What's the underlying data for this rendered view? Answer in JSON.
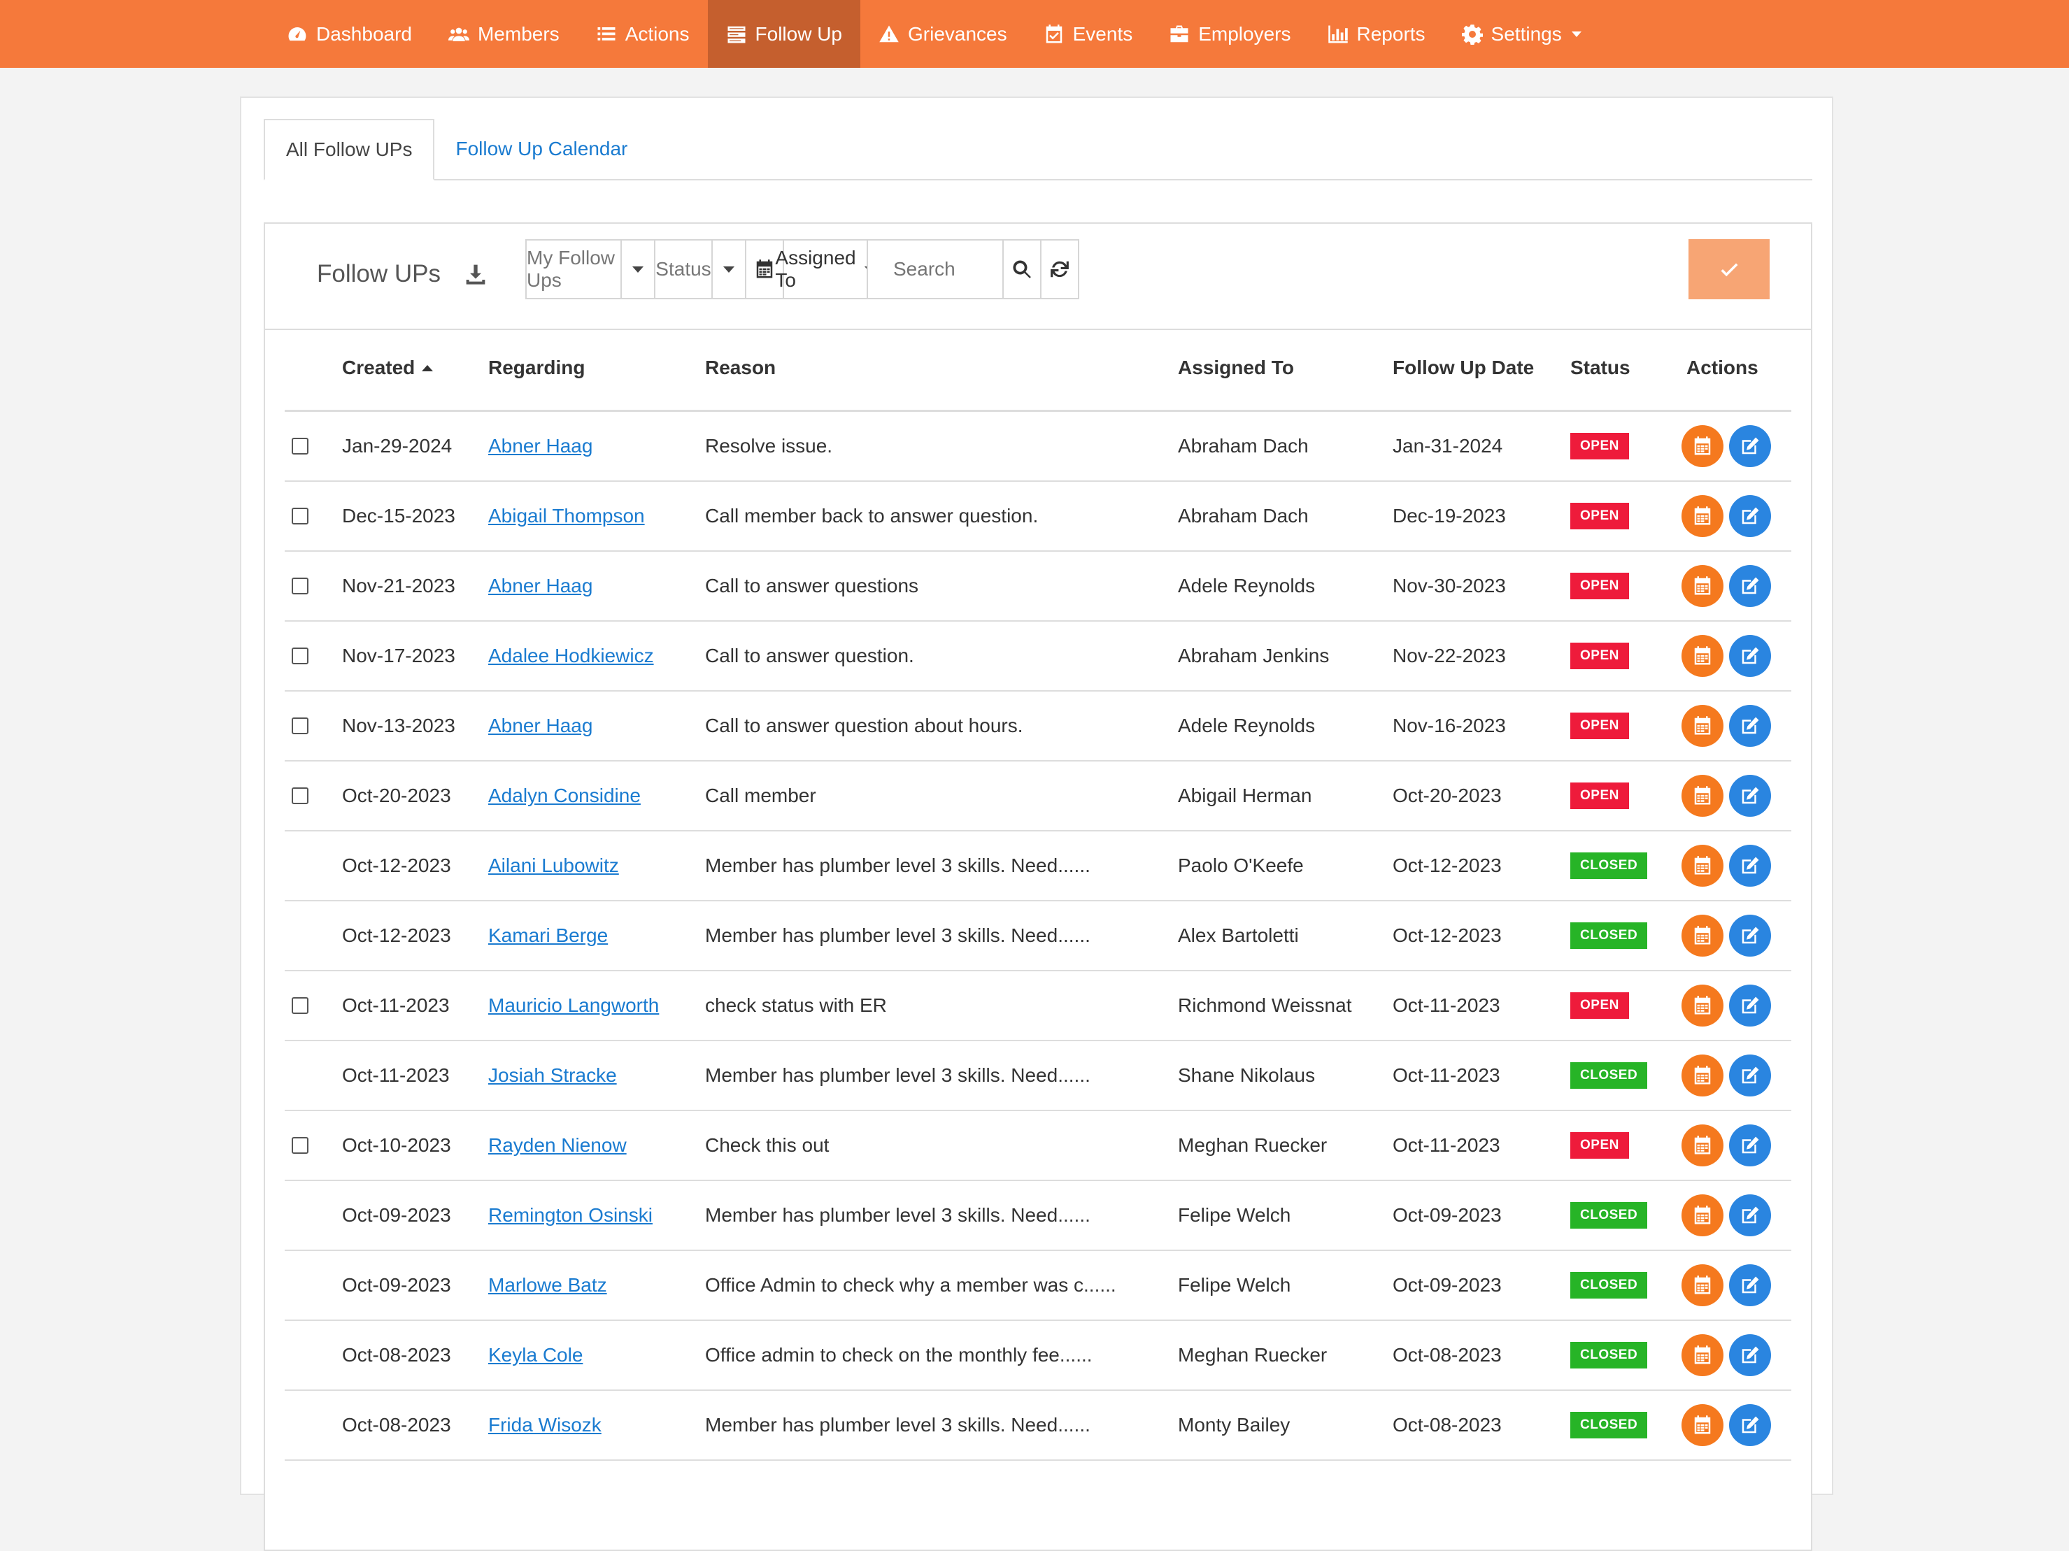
{
  "nav": {
    "items": [
      {
        "label": "Dashboard",
        "icon": "dashboard-icon"
      },
      {
        "label": "Members",
        "icon": "users-icon"
      },
      {
        "label": "Actions",
        "icon": "list-icon"
      },
      {
        "label": "Follow Up",
        "icon": "tasks-icon"
      },
      {
        "label": "Grievances",
        "icon": "warning-icon"
      },
      {
        "label": "Events",
        "icon": "calendar-check-icon"
      },
      {
        "label": "Employers",
        "icon": "briefcase-icon"
      },
      {
        "label": "Reports",
        "icon": "bar-chart-icon"
      },
      {
        "label": "Settings",
        "icon": "gear-icon"
      }
    ],
    "active": "Follow Up"
  },
  "tabs": {
    "all": "All Follow UPs",
    "calendar": "Follow Up Calendar"
  },
  "toolbar": {
    "title": "Follow UPs",
    "filter_mine": "My Follow Ups",
    "filter_status": "Status",
    "filter_assigned": "Assigned To",
    "search_placeholder": "Search"
  },
  "table": {
    "headers": {
      "created": "Created",
      "regarding": "Regarding",
      "reason": "Reason",
      "assigned": "Assigned To",
      "followup": "Follow Up Date",
      "status": "Status",
      "actions": "Actions"
    },
    "rows": [
      {
        "checkbox": true,
        "created": "Jan-29-2024",
        "regarding": "Abner Haag",
        "reason": "Resolve issue.",
        "assigned": "Abraham Dach",
        "followup": "Jan-31-2024",
        "status": "OPEN"
      },
      {
        "checkbox": true,
        "created": "Dec-15-2023",
        "regarding": "Abigail Thompson",
        "reason": "Call member back to answer question.",
        "assigned": "Abraham Dach",
        "followup": "Dec-19-2023",
        "status": "OPEN"
      },
      {
        "checkbox": true,
        "created": "Nov-21-2023",
        "regarding": "Abner Haag",
        "reason": "Call to answer questions",
        "assigned": "Adele Reynolds",
        "followup": "Nov-30-2023",
        "status": "OPEN"
      },
      {
        "checkbox": true,
        "created": "Nov-17-2023",
        "regarding": "Adalee Hodkiewicz",
        "reason": "Call to answer question.",
        "assigned": "Abraham Jenkins",
        "followup": "Nov-22-2023",
        "status": "OPEN"
      },
      {
        "checkbox": true,
        "created": "Nov-13-2023",
        "regarding": "Abner Haag",
        "reason": "Call to answer question about hours.",
        "assigned": "Adele Reynolds",
        "followup": "Nov-16-2023",
        "status": "OPEN"
      },
      {
        "checkbox": true,
        "created": "Oct-20-2023",
        "regarding": "Adalyn Considine",
        "reason": "Call member",
        "assigned": "Abigail Herman",
        "followup": "Oct-20-2023",
        "status": "OPEN"
      },
      {
        "checkbox": false,
        "created": "Oct-12-2023",
        "regarding": "Ailani Lubowitz",
        "reason": "Member has plumber level 3 skills. Need......",
        "assigned": "Paolo O'Keefe",
        "followup": "Oct-12-2023",
        "status": "CLOSED"
      },
      {
        "checkbox": false,
        "created": "Oct-12-2023",
        "regarding": "Kamari Berge",
        "reason": "Member has plumber level 3 skills. Need......",
        "assigned": "Alex Bartoletti",
        "followup": "Oct-12-2023",
        "status": "CLOSED"
      },
      {
        "checkbox": true,
        "created": "Oct-11-2023",
        "regarding": "Mauricio Langworth",
        "reason": "check status with ER",
        "assigned": "Richmond Weissnat",
        "followup": "Oct-11-2023",
        "status": "OPEN"
      },
      {
        "checkbox": false,
        "created": "Oct-11-2023",
        "regarding": "Josiah Stracke",
        "reason": "Member has plumber level 3 skills. Need......",
        "assigned": "Shane Nikolaus",
        "followup": "Oct-11-2023",
        "status": "CLOSED"
      },
      {
        "checkbox": true,
        "created": "Oct-10-2023",
        "regarding": "Rayden Nienow",
        "reason": "Check this out",
        "assigned": "Meghan Ruecker",
        "followup": "Oct-11-2023",
        "status": "OPEN"
      },
      {
        "checkbox": false,
        "created": "Oct-09-2023",
        "regarding": "Remington Osinski",
        "reason": "Member has plumber level 3 skills. Need......",
        "assigned": "Felipe Welch",
        "followup": "Oct-09-2023",
        "status": "CLOSED"
      },
      {
        "checkbox": false,
        "created": "Oct-09-2023",
        "regarding": "Marlowe Batz",
        "reason": "Office Admin to check why a member was c......",
        "assigned": "Felipe Welch",
        "followup": "Oct-09-2023",
        "status": "CLOSED"
      },
      {
        "checkbox": false,
        "created": "Oct-08-2023",
        "regarding": "Keyla Cole",
        "reason": "Office admin to check on the monthly fee......",
        "assigned": "Meghan Ruecker",
        "followup": "Oct-08-2023",
        "status": "CLOSED"
      },
      {
        "checkbox": false,
        "created": "Oct-08-2023",
        "regarding": "Frida Wisozk",
        "reason": "Member has plumber level 3 skills. Need......",
        "assigned": "Monty Bailey",
        "followup": "Oct-08-2023",
        "status": "CLOSED"
      }
    ]
  },
  "colors": {
    "nav": "#f5793b",
    "nav_active": "#c55f2e",
    "open": "#ee1b3b",
    "closed": "#27b427",
    "link": "#1a7bd0",
    "action_calendar": "#f5791e",
    "action_edit": "#2a85e0"
  }
}
